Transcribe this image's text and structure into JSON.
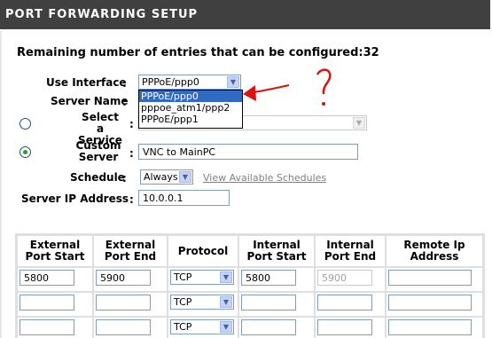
{
  "header": {
    "title": "PORT FORWARDING SETUP"
  },
  "remaining": "Remaining number of entries that can be configured:32",
  "form": {
    "use_interface_label": "Use Interface",
    "use_interface_value": "PPPoE/ppp0",
    "server_name_label": "Server Name",
    "select_service_label": "Select a Service",
    "custom_server_label": "Custom Server",
    "custom_server_value": "VNC to MainPC",
    "schedule_label": "Schedule",
    "schedule_value": "Always",
    "view_schedules_link": "View Available Schedules",
    "server_ip_label": "Server IP Address",
    "server_ip_value": "10.0.0.1",
    "colon": ":"
  },
  "dropdown": {
    "options": [
      "PPPoE/ppp0",
      "pppoe_atm1/ppp2",
      "PPPoE/ppp1"
    ],
    "selected_index": 0
  },
  "annotation": {
    "color": "#e01010"
  },
  "table": {
    "headers": [
      "External Port Start",
      "External Port End",
      "Protocol",
      "Internal Port Start",
      "Internal Port End",
      "Remote Ip Address"
    ],
    "rows": [
      {
        "ext_start": "5800",
        "ext_end": "5900",
        "protocol": "TCP",
        "int_start": "5800",
        "int_end": "5900",
        "remote_ip": ""
      },
      {
        "ext_start": "",
        "ext_end": "",
        "protocol": "TCP",
        "int_start": "",
        "int_end": "",
        "remote_ip": ""
      },
      {
        "ext_start": "",
        "ext_end": "",
        "protocol": "TCP",
        "int_start": "",
        "int_end": "",
        "remote_ip": ""
      }
    ]
  }
}
